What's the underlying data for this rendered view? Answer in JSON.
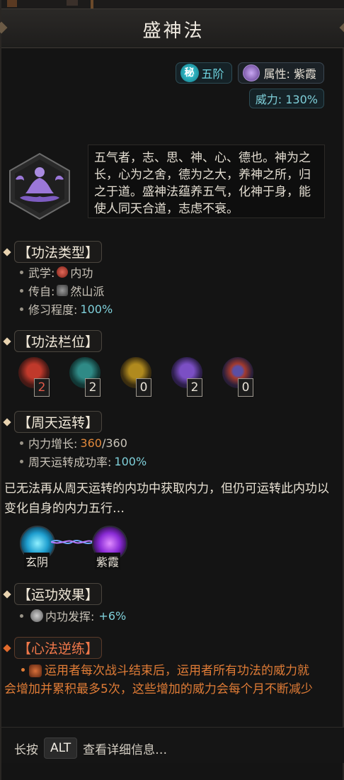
{
  "title": "盛神法",
  "rank": {
    "badge": "秘",
    "label": "五阶"
  },
  "attribute": "属性: 紫霞",
  "power": "威力: 130%",
  "description": "五气者，志、思、神、心、德也。神为之长，心为之舍，德为之大，养神之所，归之于道。盛神法蕴养五气，化神于身，能使人同天合道，志虑不衰。",
  "sections": {
    "type": {
      "title": "【功法类型】",
      "martial_label": "武学:",
      "martial_value": "内功",
      "origin_label": "传自:",
      "origin_value": "然山派",
      "practice_label": "修习程度:",
      "practice_value": "100%"
    },
    "slots": {
      "title": "【功法栏位】",
      "items": [
        {
          "count": "2",
          "color": "#c0392b"
        },
        {
          "count": "2",
          "color": "#2f8a86"
        },
        {
          "count": "0",
          "color": "#b08a1e"
        },
        {
          "count": "2",
          "color": "#7b4fc4"
        },
        {
          "count": "0",
          "color": "#5b4fa4"
        }
      ]
    },
    "cycle": {
      "title": "【周天运转】",
      "growth_label": "内力增长:",
      "growth_current": "360",
      "growth_total": "/360",
      "rate_label": "周天运转成功率:",
      "rate_value": "100%"
    },
    "note": "已无法再从周天运转的内功中获取内力，但仍可运转此内功以变化自身的内力五行…",
    "transform": {
      "from": "玄阴",
      "to": "紫霞"
    },
    "effect": {
      "title": "【运功效果】",
      "label": "内功发挥:",
      "value": "+6%"
    },
    "reverse": {
      "title": "【心法逆练】",
      "text": "运用者每次战斗结束后，运用者所有功法的威力就会增加并累积最多5次，这些增加的威力会每个月不断减少"
    }
  },
  "footer": {
    "prefix": "长按",
    "key": "ALT",
    "suffix": "查看详细信息…"
  },
  "colors": {
    "teal": "#7fd0da",
    "orange": "#e07c36",
    "purple": "#9b6fd6"
  }
}
